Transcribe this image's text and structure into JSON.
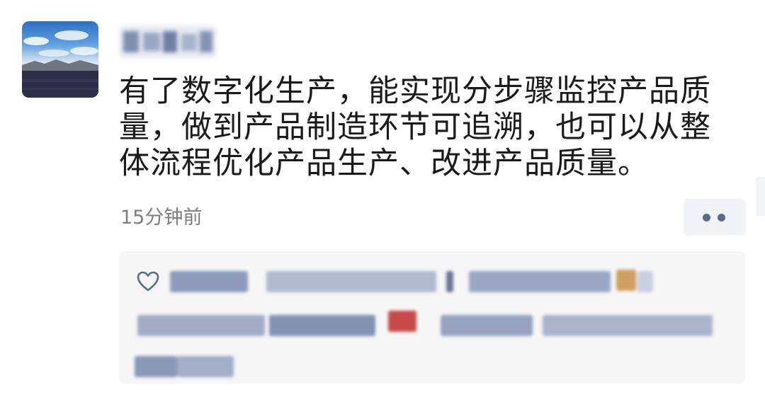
{
  "post": {
    "author_name": "",
    "avatar_icon": "avatar-landscape-icon",
    "content_lines": [
      "有了数字化生产，能实现分步骤监控产品质",
      "量，做到产品制造环节可追溯，也可以从整",
      "体流程优化产品生产、改进产品质量。"
    ],
    "timestamp": "15分钟前",
    "more_icon": "more-dots-icon",
    "like_icon": "heart-outline-icon",
    "likes_text": ""
  },
  "colors": {
    "text": "#1a1a1a",
    "timestamp": "#7e7e7e",
    "more_dots": "#5a6a8c",
    "likes_panel": "#f6f6f7",
    "like_names": "#5a6a8c"
  }
}
